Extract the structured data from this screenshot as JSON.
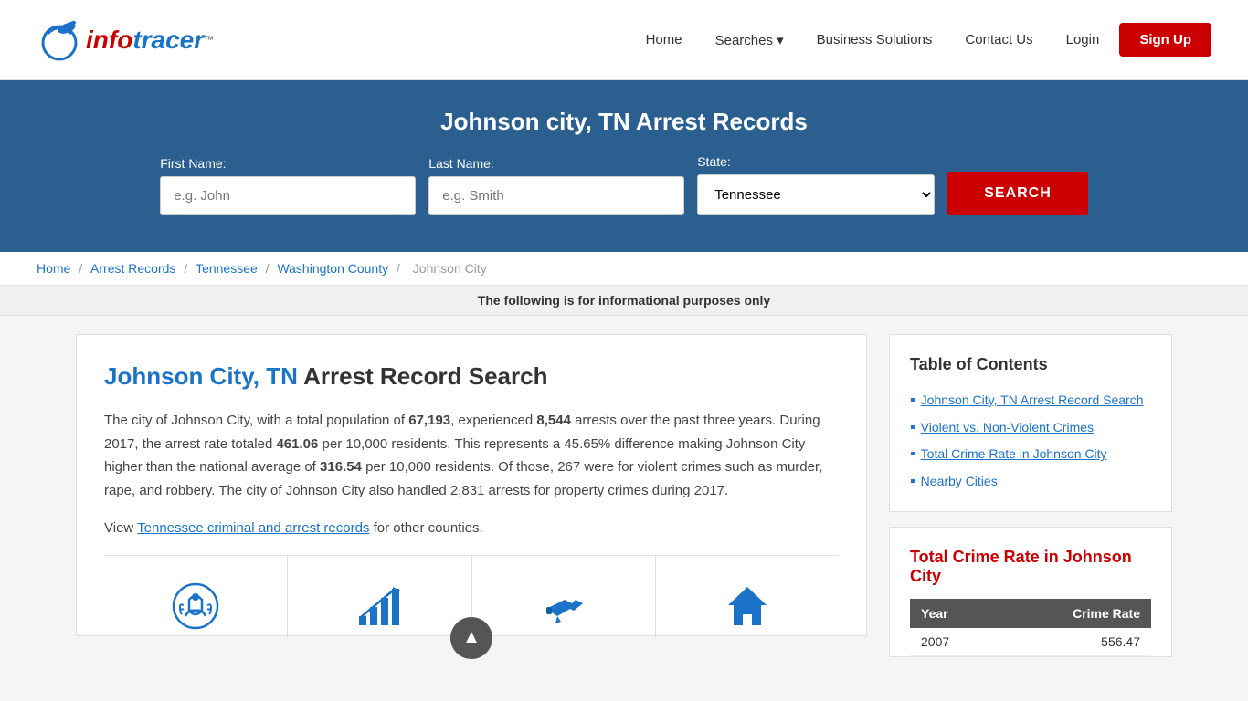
{
  "header": {
    "logo_red": "info",
    "logo_blue": "tracer",
    "logo_tm": "™",
    "nav": {
      "home": "Home",
      "searches": "Searches",
      "searches_chevron": "▾",
      "business": "Business Solutions",
      "contact": "Contact Us",
      "login": "Login",
      "signup": "Sign Up"
    }
  },
  "hero": {
    "title": "Johnson city, TN Arrest Records",
    "form": {
      "first_name_label": "First Name:",
      "first_name_placeholder": "e.g. John",
      "last_name_label": "Last Name:",
      "last_name_placeholder": "e.g. Smith",
      "state_label": "State:",
      "state_value": "Tennessee",
      "search_button": "SEARCH"
    }
  },
  "breadcrumb": {
    "home": "Home",
    "arrest": "Arrest Records",
    "state": "Tennessee",
    "county": "Washington County",
    "city": "Johnson City",
    "sep": "/"
  },
  "info_bar": "The following is for informational purposes only",
  "main": {
    "heading_blue": "Johnson City, TN",
    "heading_black": " Arrest Record Search",
    "paragraph1": "The city of Johnson City, with a total population of 67,193, experienced 8,544 arrests over the past three years. During 2017, the arrest rate totaled 461.06 per 10,000 residents. This represents a 45.65% difference making Johnson City higher than the national average of 316.54 per 10,000 residents. Of those, 267 were for violent crimes such as murder, rape, and robbery. The city of Johnson City also handled 2,831 arrests for property crimes during 2017.",
    "view_text": "View ",
    "tn_link": "Tennessee criminal and arrest records",
    "view_suffix": " for other counties.",
    "icons": [
      {
        "name": "arrests-icon",
        "symbol": "🔗"
      },
      {
        "name": "crime-rate-icon",
        "symbol": "📈"
      },
      {
        "name": "weapons-icon",
        "symbol": "🔫"
      },
      {
        "name": "property-icon",
        "symbol": "🏠"
      }
    ]
  },
  "toc": {
    "heading": "Table of Contents",
    "items": [
      {
        "label": "Johnson City, TN Arrest Record Search",
        "href": "#search"
      },
      {
        "label": "Violent vs. Non-Violent Crimes",
        "href": "#violent"
      },
      {
        "label": "Total Crime Rate in Johnson City",
        "href": "#crime-rate"
      },
      {
        "label": "Nearby Cities",
        "href": "#nearby"
      }
    ]
  },
  "crime_rate": {
    "heading": "Total Crime Rate in Johnson City",
    "table_headers": [
      "Year",
      "Crime Rate"
    ],
    "rows": [
      {
        "year": "2007",
        "rate": "556.47"
      }
    ]
  },
  "scroll_top_label": "▲"
}
